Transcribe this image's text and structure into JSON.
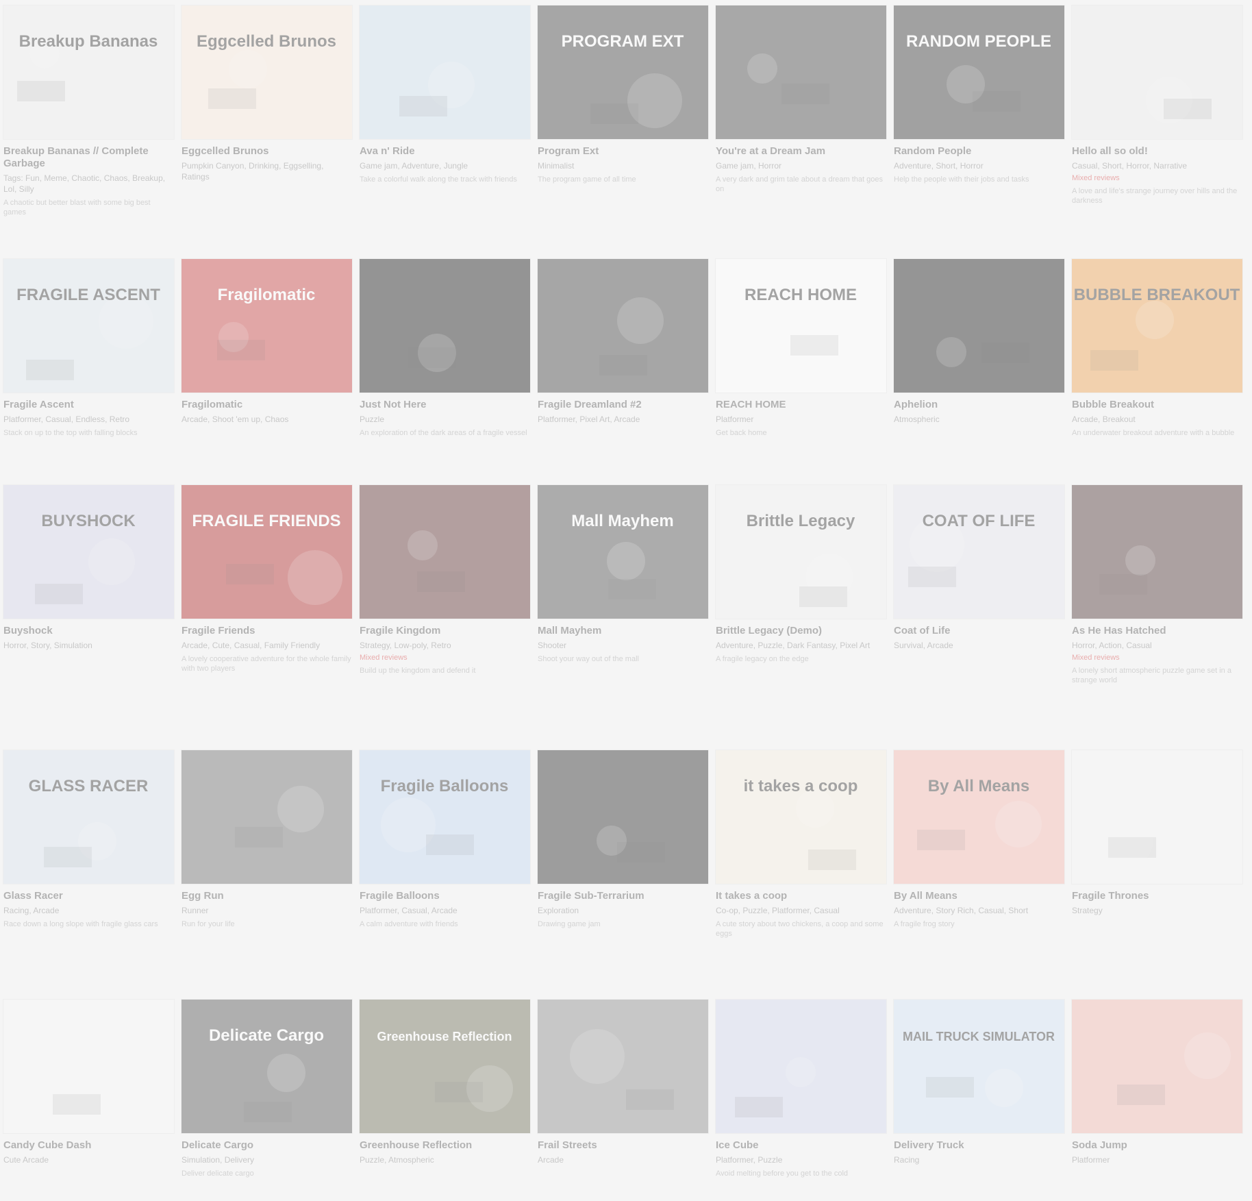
{
  "games": [
    {
      "title": "Breakup Bananas // Complete Garbage",
      "tags": "Tags: Fun, Meme, Chaotic, Chaos, Breakup, Lol, Silly",
      "status": "",
      "desc": "A chaotic but better blast with some big best games",
      "thumb_bg": "#eeeeee",
      "thumb_text": "Breakup Bananas"
    },
    {
      "title": "Eggcelled Brunos",
      "tags": "Pumpkin Canyon, Drinking, Eggselling, Ratings",
      "status": "",
      "desc": "",
      "thumb_bg": "#fbeadc",
      "thumb_text": "Eggcelled Brunos"
    },
    {
      "title": "Ava n' Ride",
      "tags": "Game jam, Adventure, Jungle",
      "status": "",
      "desc": "Take a colorful walk along the track with friends",
      "thumb_bg": "#cfe1ef",
      "thumb_text": ""
    },
    {
      "title": "Program Ext",
      "tags": "Minimalist",
      "status": "",
      "desc": "The program game of all time",
      "thumb_bg": "#3a3a3a",
      "thumb_text": "PROGRAM EXT"
    },
    {
      "title": "You're at a Dream Jam",
      "tags": "Game jam, Horror",
      "status": "",
      "desc": "A very dark and grim tale about a dream that goes on",
      "thumb_bg": "#3f3f3f",
      "thumb_text": ""
    },
    {
      "title": "Random People",
      "tags": "Adventure, Short, Horror",
      "status": "",
      "desc": "Help the people with their jobs and tasks",
      "thumb_bg": "#2e2e2e",
      "thumb_text": "RANDOM PEOPLE"
    },
    {
      "title": "Hello all so old!",
      "tags": "Casual, Short, Horror, Narrative",
      "status": "Mixed reviews",
      "desc": "A love and life's strange journey over hills and the darkness",
      "thumb_bg": "#ececec",
      "thumb_text": ""
    },
    {
      "title": "Fragile Ascent",
      "tags": "Platformer, Casual, Endless, Retro",
      "status": "",
      "desc": "Stack on up to the top with falling blocks",
      "thumb_bg": "#dfe7ee",
      "thumb_text": "FRAGILE ASCENT"
    },
    {
      "title": "Fragilomatic",
      "tags": "Arcade, Shoot 'em up, Chaos",
      "status": "",
      "desc": "",
      "thumb_bg": "#c73a3a",
      "thumb_text": "Fragilomatic"
    },
    {
      "title": "Just Not Here",
      "tags": "Puzzle",
      "status": "",
      "desc": "An exploration of the dark areas of a fragile vessel",
      "thumb_bg": "#111111",
      "thumb_text": ""
    },
    {
      "title": "Fragile Dreamland #2",
      "tags": "Platformer, Pixel Art, Arcade",
      "status": "",
      "desc": "",
      "thumb_bg": "#3a3a3a",
      "thumb_text": ""
    },
    {
      "title": "REACH HOME",
      "tags": "Platformer",
      "status": "",
      "desc": "Get back home",
      "thumb_bg": "#ffffff",
      "thumb_text": "REACH HOME"
    },
    {
      "title": "Aphelion",
      "tags": "Atmospheric",
      "status": "",
      "desc": "",
      "thumb_bg": "#121212",
      "thumb_text": ""
    },
    {
      "title": "Bubble Breakout",
      "tags": "Arcade, Breakout",
      "status": "",
      "desc": "An underwater breakout adventure with a bubble",
      "thumb_bg": "#f0a14e",
      "thumb_text": "BUBBLE BREAKOUT"
    },
    {
      "title": "Buyshock",
      "tags": "Horror, Story, Simulation",
      "status": "",
      "desc": "",
      "thumb_bg": "#d6d6ea",
      "thumb_text": "BUYSHOCK"
    },
    {
      "title": "Fragile Friends",
      "tags": "Arcade, Cute, Casual, Family Friendly",
      "status": "",
      "desc": "A lovely cooperative adventure for the whole family with two players",
      "thumb_bg": "#b02424",
      "thumb_text": "FRAGILE FRIENDS"
    },
    {
      "title": "Fragile Kingdom",
      "tags": "Strategy, Low-poly, Retro",
      "status": "Mixed reviews",
      "desc": "Build up the kingdom and defend it",
      "thumb_bg": "#5a2a2a",
      "thumb_text": ""
    },
    {
      "title": "Mall Mayhem",
      "tags": "Shooter",
      "status": "",
      "desc": "Shoot your way out of the mall",
      "thumb_bg": "#4a4a4a",
      "thumb_text": "Mall Mayhem"
    },
    {
      "title": "Brittle Legacy (Demo)",
      "tags": "Adventure, Puzzle, Dark Fantasy, Pixel Art",
      "status": "",
      "desc": "A fragile legacy on the edge",
      "thumb_bg": "#f2f2f2",
      "thumb_text": "Brittle Legacy"
    },
    {
      "title": "Coat of Life",
      "tags": "Survival, Arcade",
      "status": "",
      "desc": "",
      "thumb_bg": "#e6e6f0",
      "thumb_text": "COAT OF LIFE"
    },
    {
      "title": "As He Has Hatched",
      "tags": "Horror, Action, Casual",
      "status": "Mixed reviews",
      "desc": "A lonely short atmospheric puzzle game set in a strange world",
      "thumb_bg": "#4a2f2f",
      "thumb_text": ""
    },
    {
      "title": "Glass Racer",
      "tags": "Racing, Arcade",
      "status": "",
      "desc": "Race down a long slope with fragile glass cars",
      "thumb_bg": "#d9e4f0",
      "thumb_text": "GLASS RACER"
    },
    {
      "title": "Egg Run",
      "tags": "Runner",
      "status": "",
      "desc": "Run for your life",
      "thumb_bg": "#6a6a6a",
      "thumb_text": ""
    },
    {
      "title": "Fragile Balloons",
      "tags": "Platformer, Casual, Arcade",
      "status": "",
      "desc": "A calm adventure with friends",
      "thumb_bg": "#c3d8f2",
      "thumb_text": "Fragile Balloons"
    },
    {
      "title": "Fragile Sub-Terrarium",
      "tags": "Exploration",
      "status": "",
      "desc": "Drawing game jam",
      "thumb_bg": "#252525",
      "thumb_text": ""
    },
    {
      "title": "It takes a coop",
      "tags": "Co-op, Puzzle, Platformer, Casual",
      "status": "",
      "desc": "A cute story about two chickens, a coop and some eggs",
      "thumb_bg": "#f7f0e0",
      "thumb_text": "it takes a coop"
    },
    {
      "title": "By All Means",
      "tags": "Adventure, Story Rich, Casual, Short",
      "status": "",
      "desc": "A fragile frog story",
      "thumb_bg": "#f5b5ac",
      "thumb_text": "By All Means"
    },
    {
      "title": "Fragile Thrones",
      "tags": "Strategy",
      "status": "",
      "desc": "",
      "thumb_bg": "#f6f6f6",
      "thumb_text": ""
    },
    {
      "title": "Candy Cube Dash",
      "tags": "Cute Arcade",
      "status": "",
      "desc": "",
      "thumb_bg": "#f8f8f8",
      "thumb_text": ""
    },
    {
      "title": "Delicate Cargo",
      "tags": "Simulation, Delivery",
      "status": "",
      "desc": "Deliver delicate cargo",
      "thumb_bg": "#505050",
      "thumb_text": "Delicate Cargo"
    },
    {
      "title": "Greenhouse Reflection",
      "tags": "Puzzle, Atmospheric",
      "status": "",
      "desc": "",
      "thumb_bg": "#6d6d56",
      "thumb_text": "Greenhouse Reflection"
    },
    {
      "title": "Frail Streets",
      "tags": "Arcade",
      "status": "",
      "desc": "",
      "thumb_bg": "#888888",
      "thumb_text": ""
    },
    {
      "title": "Ice Cube",
      "tags": "Platformer, Puzzle",
      "status": "",
      "desc": "Avoid melting before you get to the cold",
      "thumb_bg": "#d2d7ee",
      "thumb_text": ""
    },
    {
      "title": "Delivery Truck",
      "tags": "Racing",
      "status": "",
      "desc": "",
      "thumb_bg": "#d3e4f6",
      "thumb_text": "MAIL TRUCK SIMULATOR"
    },
    {
      "title": "Soda Jump",
      "tags": "Platformer",
      "status": "",
      "desc": "",
      "thumb_bg": "#f1b6ad",
      "thumb_text": ""
    }
  ]
}
